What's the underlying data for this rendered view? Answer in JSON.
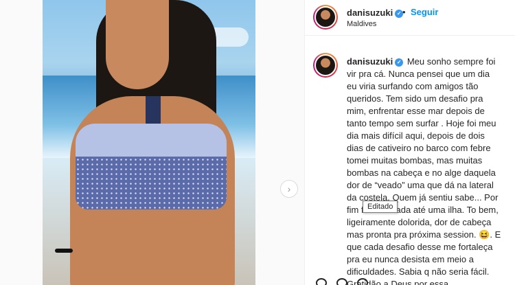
{
  "post": {
    "username": "danisuzuki",
    "follow_label": "Seguir",
    "separator": "•",
    "location": "Maldives",
    "caption": "Meu sonho sempre foi vir pra cá. Nunca pensei que um dia eu viria surfando com amigos tão queridos. Tem sido um desafio pra mim, enfrentar esse mar depois de tanto tempo sem surfar . Hoje foi meu dia mais difícil aqui, depois de dois dias de cativeiro no barco com febre tomei muitas bombas, mas muitas bombas na cabeça e no alge daquela dor de “veado” uma que dá na lateral da costela. Quem já sentiu sabe... Por fim fui arrastada até uma ilha. To bem, ligeiramente dolorida, dor de cabeça mas pronta pra próxima session. 😆. E que cada desafio desse me fortaleça pra eu nunca desista em meio a dificuldades. Sabia q não seria fácil. Gratidão a Deus por essa",
    "tooltip": "Editado"
  },
  "icons": {
    "verified": "verified-badge-icon",
    "next": "chevron-right-icon"
  },
  "colors": {
    "accent": "#0095f6",
    "verified": "#3897f0",
    "text": "#262626"
  }
}
